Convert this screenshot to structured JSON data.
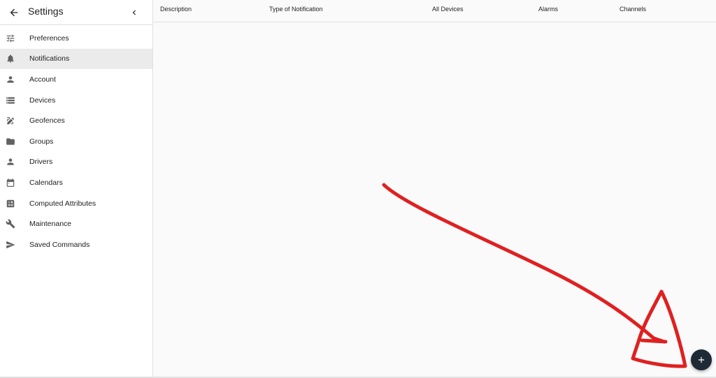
{
  "sidebar": {
    "title": "Settings",
    "items": [
      {
        "label": "Preferences",
        "icon": "tune-icon"
      },
      {
        "label": "Notifications",
        "icon": "bell-icon",
        "active": true
      },
      {
        "label": "Account",
        "icon": "person-icon"
      },
      {
        "label": "Devices",
        "icon": "storage-icon"
      },
      {
        "label": "Geofences",
        "icon": "draw-icon"
      },
      {
        "label": "Groups",
        "icon": "folder-icon"
      },
      {
        "label": "Drivers",
        "icon": "person-icon"
      },
      {
        "label": "Calendars",
        "icon": "calendar-icon"
      },
      {
        "label": "Computed Attributes",
        "icon": "calculate-icon"
      },
      {
        "label": "Maintenance",
        "icon": "wrench-icon"
      },
      {
        "label": "Saved Commands",
        "icon": "send-icon"
      }
    ]
  },
  "table": {
    "columns": [
      "Description",
      "Type of Notification",
      "All Devices",
      "Alarms",
      "Channels"
    ]
  },
  "colors": {
    "accent": "#1e2a35",
    "annotation": "#e02020"
  }
}
